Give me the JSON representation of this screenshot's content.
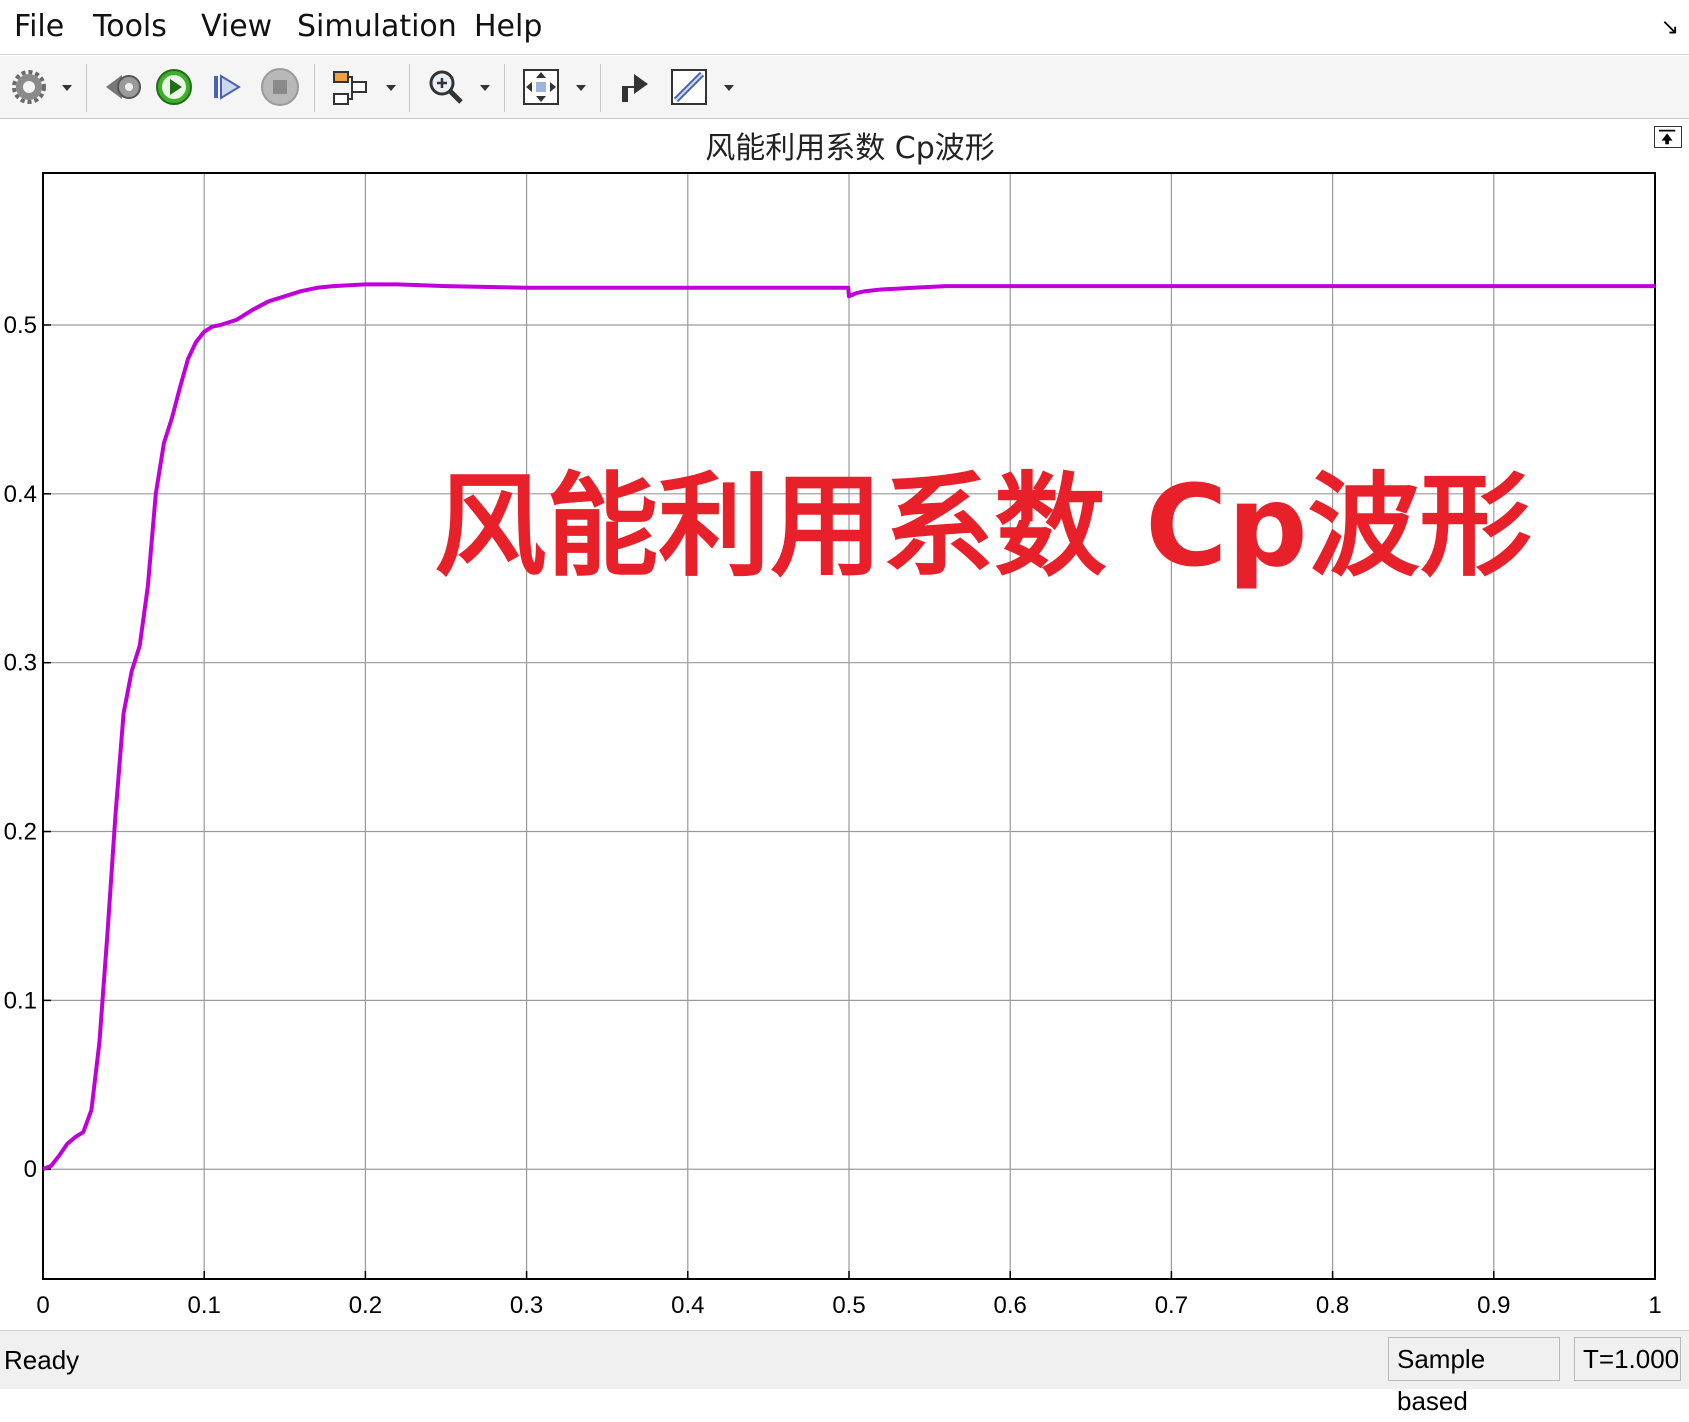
{
  "menu": {
    "items": [
      "File",
      "Tools",
      "View",
      "Simulation",
      "Help"
    ]
  },
  "toolbar": {
    "buttons": [
      "settings-icon",
      "step-back-icon",
      "run-icon",
      "step-forward-icon",
      "stop-icon",
      "highlight-block-icon",
      "zoom-icon",
      "autoscale-icon",
      "send-to-figure-icon",
      "measurements-icon"
    ]
  },
  "chart_data": {
    "type": "line",
    "title": "风能利用系数 Cp波形",
    "xlim": [
      0,
      1
    ],
    "ylim": [
      -0.065,
      0.59
    ],
    "xticks": [
      "0",
      "0.1",
      "0.2",
      "0.3",
      "0.4",
      "0.5",
      "0.6",
      "0.7",
      "0.8",
      "0.9",
      "1"
    ],
    "yticks": [
      "0",
      "0.1",
      "0.2",
      "0.3",
      "0.4",
      "0.5"
    ],
    "grid": true,
    "line_color": "#c000d8",
    "series": [
      {
        "x": [
          0,
          0.005,
          0.01,
          0.015,
          0.02,
          0.025,
          0.03,
          0.035,
          0.04,
          0.045,
          0.05,
          0.055,
          0.06,
          0.065,
          0.07,
          0.075,
          0.08,
          0.085,
          0.09,
          0.095,
          0.1,
          0.105,
          0.11,
          0.12,
          0.13,
          0.14,
          0.15,
          0.16,
          0.17,
          0.18,
          0.2,
          0.22,
          0.25,
          0.3,
          0.35,
          0.4,
          0.45,
          0.4995,
          0.5,
          0.505,
          0.51,
          0.52,
          0.54,
          0.56,
          0.6,
          0.7,
          0.8,
          0.9,
          1.0
        ],
        "y": [
          0.0,
          0.002,
          0.008,
          0.015,
          0.019,
          0.022,
          0.035,
          0.075,
          0.14,
          0.21,
          0.27,
          0.295,
          0.31,
          0.345,
          0.4,
          0.43,
          0.445,
          0.463,
          0.48,
          0.49,
          0.496,
          0.499,
          0.5,
          0.503,
          0.509,
          0.514,
          0.517,
          0.52,
          0.522,
          0.523,
          0.524,
          0.524,
          0.523,
          0.522,
          0.522,
          0.522,
          0.522,
          0.522,
          0.517,
          0.519,
          0.52,
          0.521,
          0.522,
          0.523,
          0.523,
          0.523,
          0.523,
          0.523,
          0.523
        ]
      }
    ]
  },
  "overlay": {
    "caption": "风能利用系数 Cp波形",
    "color": "#e8202a"
  },
  "status": {
    "text": "Ready",
    "mode": "Sample based",
    "time": "T=1.000"
  }
}
